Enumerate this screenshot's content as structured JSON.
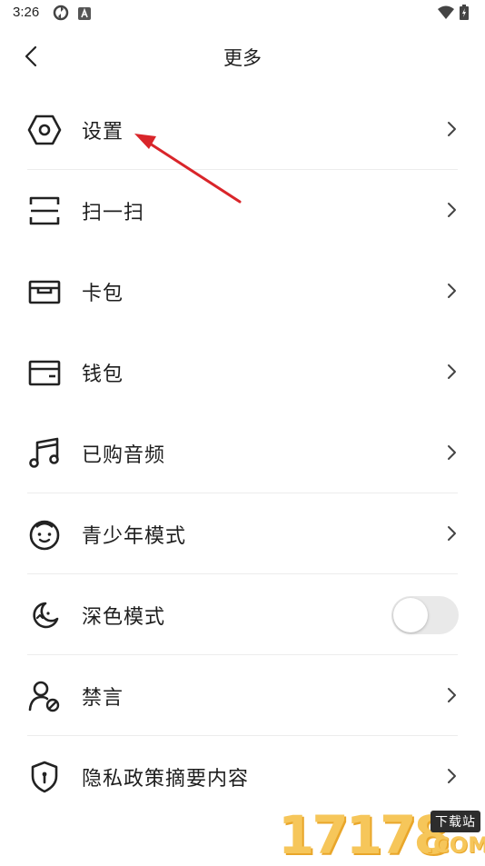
{
  "status_bar": {
    "time": "3:26",
    "left_icons": [
      "sync-icon",
      "a-notification-icon"
    ],
    "right_icons": [
      "wifi-icon",
      "battery-charging-icon"
    ]
  },
  "header": {
    "title": "更多",
    "back_icon": "chevron-left-icon"
  },
  "menu": {
    "items": [
      {
        "label": "设置",
        "icon": "settings-hex-icon",
        "action": "chevron"
      },
      {
        "label": "扫一扫",
        "icon": "scan-icon",
        "action": "chevron"
      },
      {
        "label": "卡包",
        "icon": "card-wallet-icon",
        "action": "chevron"
      },
      {
        "label": "钱包",
        "icon": "wallet-icon",
        "action": "chevron"
      },
      {
        "label": "已购音频",
        "icon": "music-note-icon",
        "action": "chevron"
      },
      {
        "label": "青少年模式",
        "icon": "child-face-icon",
        "action": "chevron"
      },
      {
        "label": "深色模式",
        "icon": "dark-mode-moon-icon",
        "action": "toggle",
        "toggle_on": false
      },
      {
        "label": "禁言",
        "icon": "user-muted-icon",
        "action": "chevron"
      },
      {
        "label": "隐私政策摘要内容",
        "icon": "privacy-shield-icon",
        "action": "chevron"
      }
    ]
  },
  "colors": {
    "text": "#1e1e1e",
    "divider": "#ececec",
    "toggle_off": "#e9e9e9",
    "annotation_arrow": "#d9252a",
    "watermark": "#f6c65a"
  },
  "watermark": {
    "number": "17178",
    "badge": "下载站",
    "domain": ".COM"
  }
}
